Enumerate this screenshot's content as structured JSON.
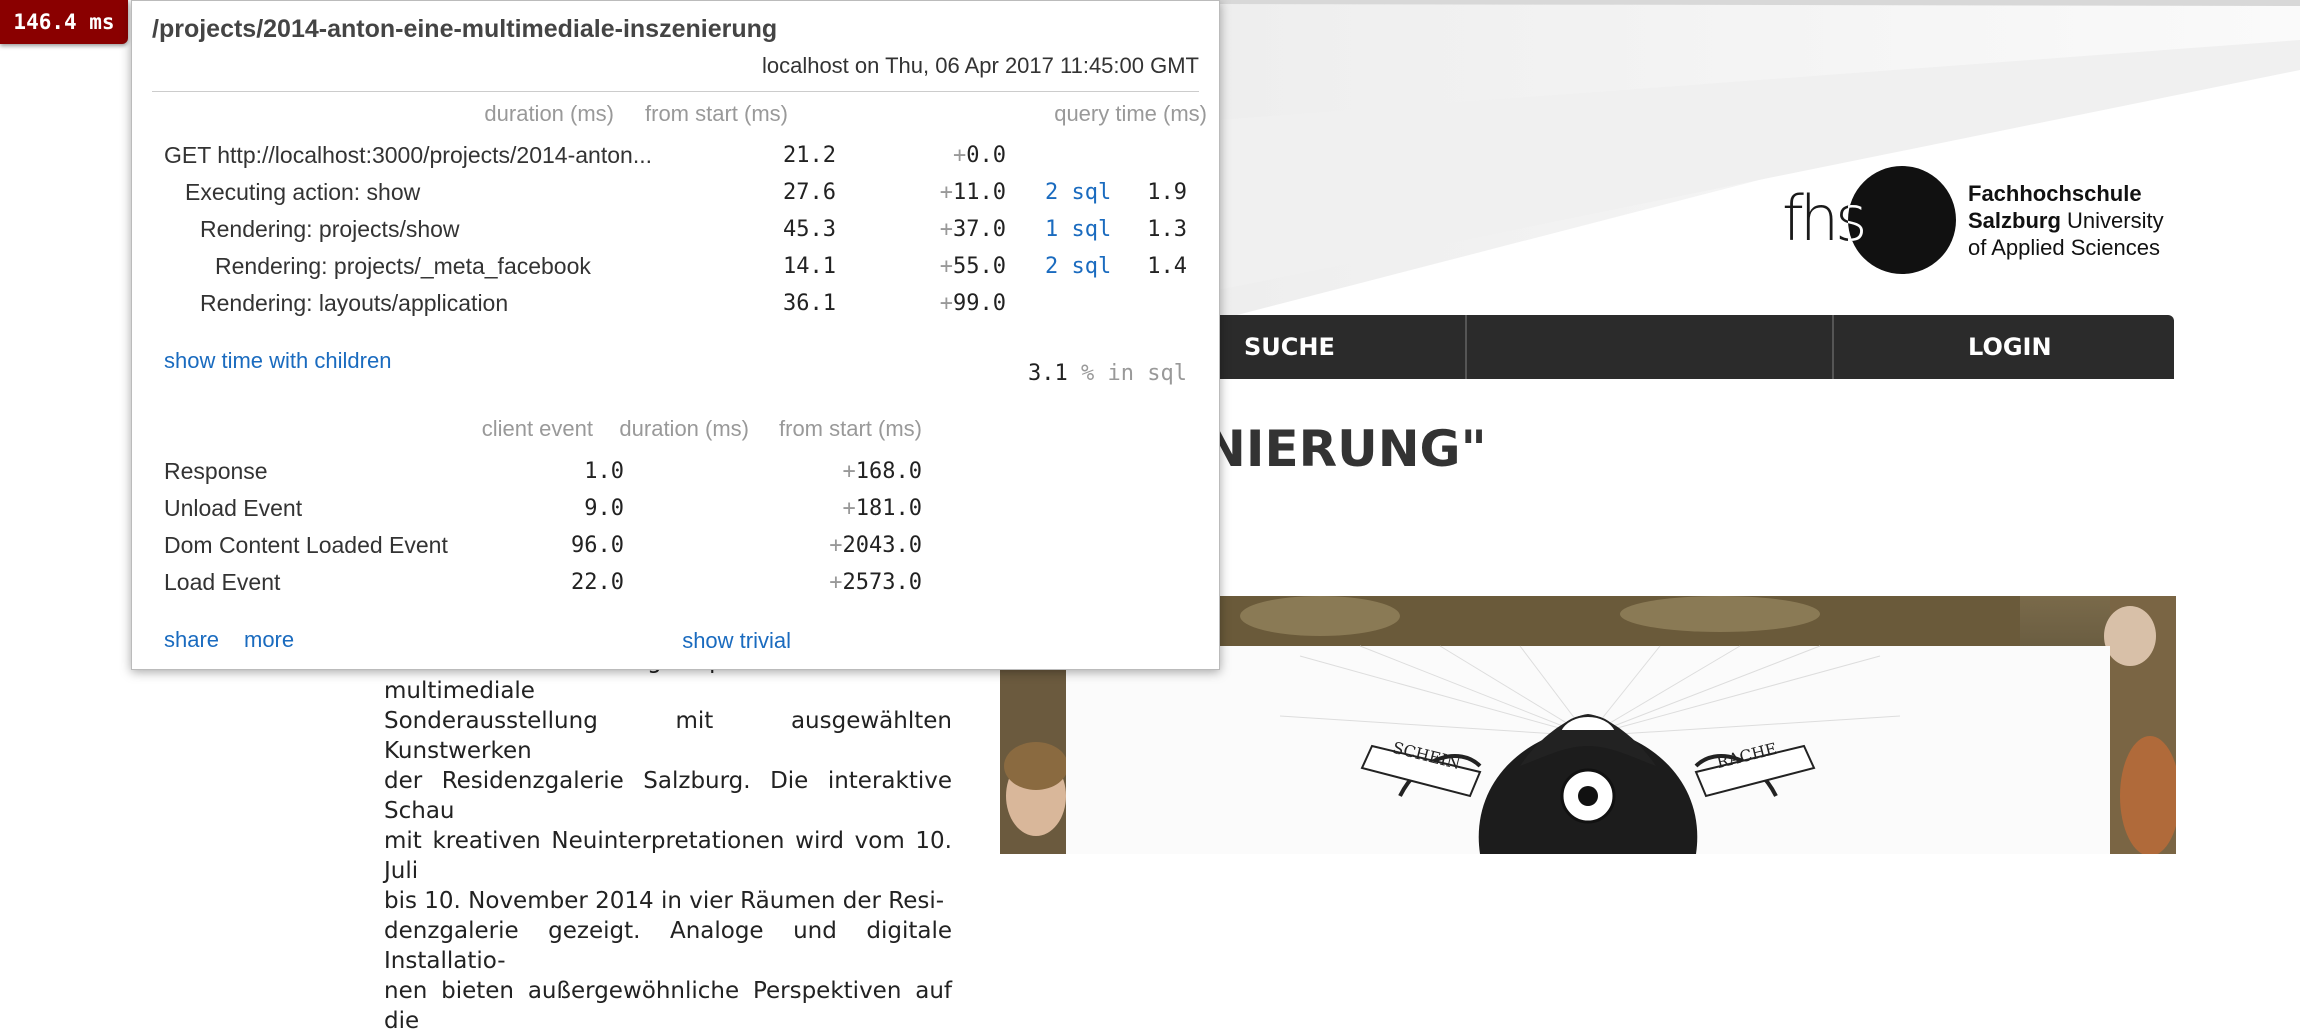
{
  "profiler": {
    "badge": "146.4 ms",
    "title": "/projects/2014-anton-eine-multimediale-inszenierung",
    "subtitle": "localhost on Thu, 06 Apr 2017 11:45:00 GMT",
    "headers": {
      "duration": "duration (ms)",
      "from_start": "from start (ms)",
      "query_time": "query time (ms)"
    },
    "timings": [
      {
        "label": "GET http://localhost:3000/projects/2014-anton...",
        "duration": "21.2",
        "from_start": "0.0",
        "sql": "",
        "query_time": ""
      },
      {
        "label": "Executing action: show",
        "duration": "27.6",
        "from_start": "11.0",
        "sql": "2 sql",
        "query_time": "1.9"
      },
      {
        "label": "Rendering: projects/show",
        "duration": "45.3",
        "from_start": "37.0",
        "sql": "1 sql",
        "query_time": "1.3"
      },
      {
        "label": "Rendering: projects/_meta_facebook",
        "duration": "14.1",
        "from_start": "55.0",
        "sql": "2 sql",
        "query_time": "1.4"
      },
      {
        "label": "Rendering: layouts/application",
        "duration": "36.1",
        "from_start": "99.0",
        "sql": "",
        "query_time": ""
      }
    ],
    "show_children": "show time with children",
    "sql_percent": "3.1",
    "sql_percent_suffix": "% in sql",
    "client_headers": {
      "event": "client event",
      "duration": "duration (ms)",
      "from_start": "from start (ms)"
    },
    "client_events": [
      {
        "label": "Response",
        "duration": "1.0",
        "from_start": "168.0"
      },
      {
        "label": "Unload Event",
        "duration": "9.0",
        "from_start": "181.0"
      },
      {
        "label": "Dom Content Loaded Event",
        "duration": "96.0",
        "from_start": "2043.0"
      },
      {
        "label": "Load Event",
        "duration": "22.0",
        "from_start": "2573.0"
      }
    ],
    "footer": {
      "share": "share",
      "more": "more",
      "trivial": "show trivial"
    }
  },
  "site": {
    "logo_mark": "fhs",
    "logo_line1": "Fachhochschule",
    "logo_line2_bold": "Salzburg",
    "logo_line2_rest": " University",
    "logo_line3": "of Applied Sciences",
    "nav": {
      "search": "SUCHE",
      "login": "LOGIN"
    },
    "headline": "NIERUNG\"",
    "body_lines": [
      "hochschule Salzburg präsentieren eine multimediale",
      "Sonderausstellung mit ausgewählten Kunstwerken",
      "der Residenzgalerie Salzburg. Die interaktive Schau",
      "mit kreativen Neuinterpretationen wird vom 10. Juli",
      "bis 10. November 2014 in vier Räumen der Resi-",
      "denzgalerie gezeigt. Analoge und digitale Installatio-",
      "nen bieten außergewöhnliche Perspektiven auf die"
    ],
    "banner_left": "SCHEIN",
    "banner_right": "RACHE"
  }
}
